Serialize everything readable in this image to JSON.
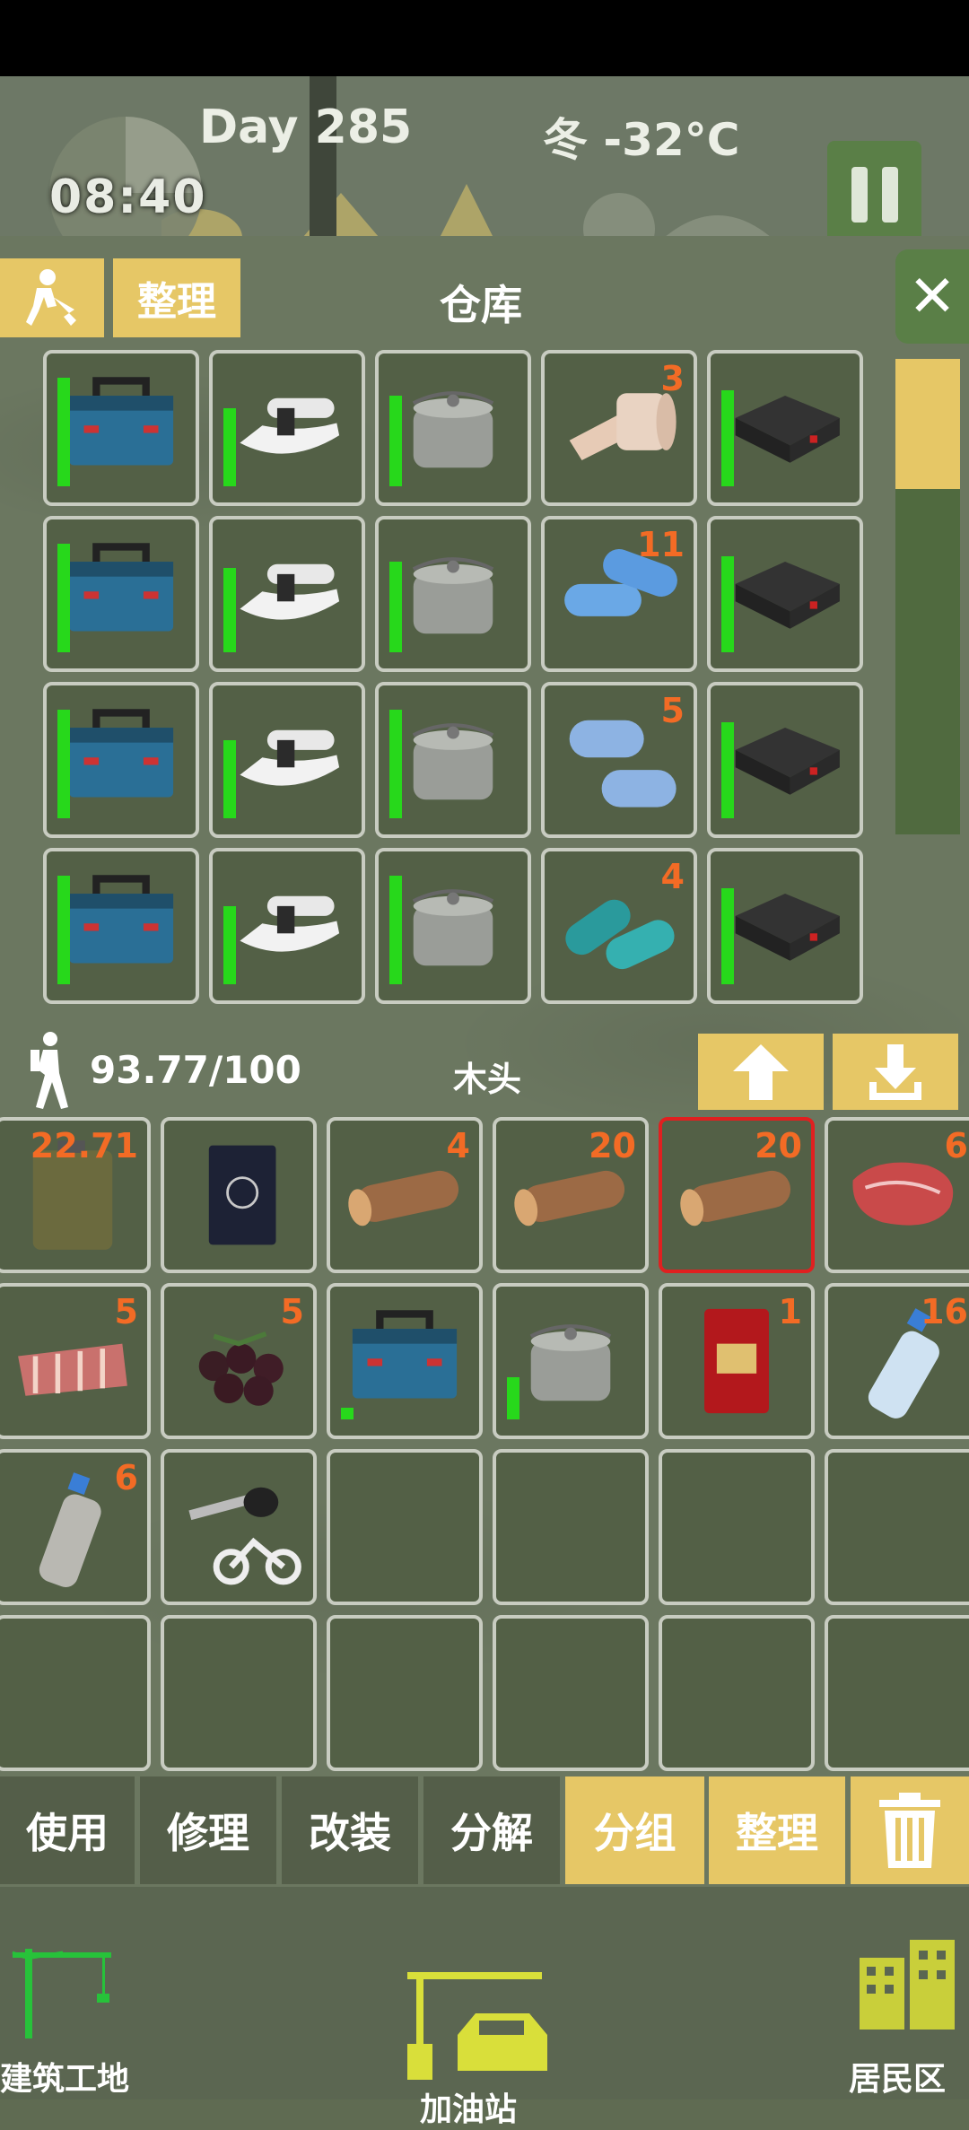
{
  "hud": {
    "time": "08:40",
    "day": "Day 285",
    "weather": "冬  -32°C"
  },
  "toolbar": {
    "sort_label": "整理",
    "title": "仓库",
    "close_label": "✕"
  },
  "storage_rows": [
    [
      {
        "icon": "toolbox-blue-icon",
        "count": "",
        "durability": 0.9
      },
      {
        "icon": "tool-white-icon",
        "count": "",
        "durability": 0.65
      },
      {
        "icon": "cooking-pot-icon",
        "count": "",
        "durability": 0.75
      },
      {
        "icon": "bandage-roll-icon",
        "count": "3",
        "durability": 0
      },
      {
        "icon": "black-case-icon",
        "count": "",
        "durability": 0.8
      }
    ],
    [
      {
        "icon": "toolbox-blue-icon",
        "count": "",
        "durability": 0.9
      },
      {
        "icon": "tool-white-icon",
        "count": "",
        "durability": 0.7
      },
      {
        "icon": "cooking-pot-icon",
        "count": "",
        "durability": 0.75
      },
      {
        "icon": "blue-capsule-icon",
        "count": "11",
        "durability": 0
      },
      {
        "icon": "black-case-icon",
        "count": "",
        "durability": 0.8
      }
    ],
    [
      {
        "icon": "toolbox-blue-icon",
        "count": "",
        "durability": 0.9
      },
      {
        "icon": "tool-white-icon",
        "count": "",
        "durability": 0.65
      },
      {
        "icon": "cooking-pot-icon",
        "count": "",
        "durability": 0.9
      },
      {
        "icon": "blue-tablet-icon",
        "count": "5",
        "durability": 0
      },
      {
        "icon": "black-case-icon",
        "count": "",
        "durability": 0.8
      }
    ],
    [
      {
        "icon": "toolbox-blue-icon",
        "count": "",
        "durability": 0.9
      },
      {
        "icon": "tool-white-icon",
        "count": "",
        "durability": 0.65
      },
      {
        "icon": "cooking-pot-icon",
        "count": "",
        "durability": 0.9
      },
      {
        "icon": "teal-capsule-icon",
        "count": "4",
        "durability": 0
      },
      {
        "icon": "black-case-icon",
        "count": "",
        "durability": 0.8
      }
    ]
  ],
  "inventory": {
    "weight": "93.77/100",
    "selected_item": "木头",
    "rows": [
      [
        {
          "icon": "jerry-can-icon",
          "count": "22.71",
          "durability": 0
        },
        {
          "icon": "passport-icon",
          "count": "",
          "durability": 0
        },
        {
          "icon": "wood-log-icon",
          "count": "4",
          "durability": 0
        },
        {
          "icon": "wood-log-icon",
          "count": "20",
          "durability": 0
        },
        {
          "icon": "wood-log-icon",
          "count": "20",
          "durability": 0,
          "selected": true
        },
        {
          "icon": "raw-steak-icon",
          "count": "6",
          "durability": 0
        }
      ],
      [
        {
          "icon": "ribs-meat-icon",
          "count": "5",
          "durability": 0
        },
        {
          "icon": "berries-icon",
          "count": "5",
          "durability": 0
        },
        {
          "icon": "toolbox-blue-icon",
          "count": "",
          "durability": 0.1
        },
        {
          "icon": "cooking-pot-icon",
          "count": "",
          "durability": 0.35
        },
        {
          "icon": "coffee-bag-icon",
          "count": "1",
          "durability": 0
        },
        {
          "icon": "water-bottle-icon",
          "count": "16",
          "durability": 0
        }
      ],
      [
        {
          "icon": "sand-bottle-icon",
          "count": "6",
          "durability": 0
        },
        {
          "icon": "motorbike-key-icon",
          "count": "",
          "durability": 0
        },
        {
          "icon": "",
          "count": "",
          "durability": 0
        },
        {
          "icon": "",
          "count": "",
          "durability": 0
        },
        {
          "icon": "",
          "count": "",
          "durability": 0
        },
        {
          "icon": "",
          "count": "",
          "durability": 0
        }
      ],
      [
        {
          "icon": "",
          "count": "",
          "durability": 0
        },
        {
          "icon": "",
          "count": "",
          "durability": 0
        },
        {
          "icon": "",
          "count": "",
          "durability": 0
        },
        {
          "icon": "",
          "count": "",
          "durability": 0
        },
        {
          "icon": "",
          "count": "",
          "durability": 0
        },
        {
          "icon": "",
          "count": "",
          "durability": 0
        }
      ]
    ]
  },
  "actions": {
    "use": "使用",
    "repair": "修理",
    "modify": "改装",
    "dismantle": "分解",
    "group": "分组",
    "sort": "整理"
  },
  "nav": {
    "construction": "建筑工地",
    "gas_station": "加油站",
    "residential": "居民区"
  },
  "colors": {
    "gold": "#e6c766",
    "durability": "#27d81b",
    "count": "#f36b25",
    "selection": "#e02020"
  }
}
